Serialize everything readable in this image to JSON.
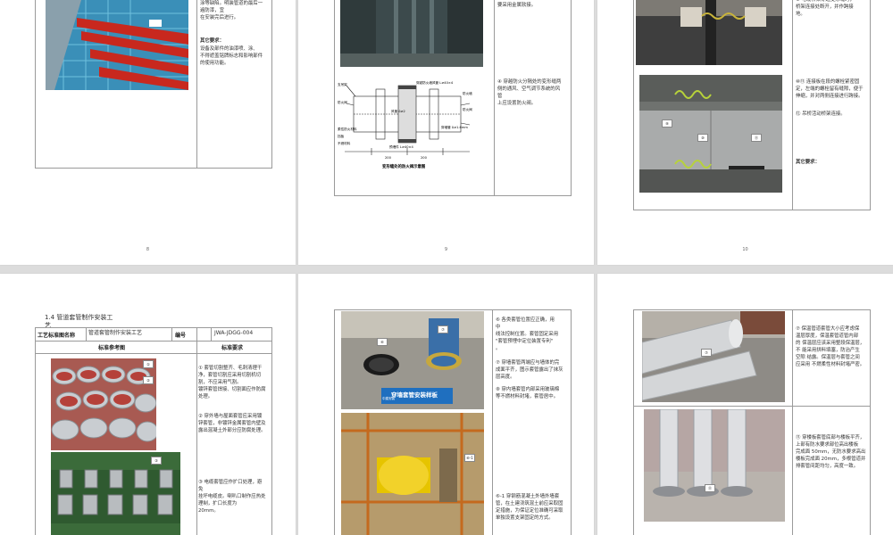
{
  "pages": [
    {
      "number": "8",
      "side_text": "涂等缺陷。明装管道的最后一\n遍防漆，宜\n在安装完后进行。",
      "req_title": "其它要求：",
      "req_text": "设备及部件的油漆喷、涂、\n不得遮盖铭牌标志和影响部件\n的使用功能。"
    },
    {
      "number": "9",
      "top_text": "要采用金属软接。",
      "item4": "④ 穿越防火分隔处的变形缝两\n侧的通风、空气调节系统的风\n管\n上应设置防火阀。",
      "diagram_caption": "变形缝处的防火阀示意图",
      "diagram_labels": [
        "支吊架",
        "防火阀",
        "穿越防火墙风管 L≥40×4",
        "防火墙",
        "风管 δ≥2",
        "穿墙管 δ≥1.6mm",
        "柔性防火材料",
        "挡板",
        "预埋件 L≥40×4",
        "200",
        "200",
        "不燃材料",
        "防火阀"
      ]
    },
    {
      "number": "10",
      "item_a": "⑨ 电缆桥架穿越变形缝时，\n桥架连接处断开，并作跨接\n地。",
      "item_b": "⑩⑪ 连接板在段的螺栓紧密固\n定，左端的螺栓留有缝隙，便于\n伸缩，并对两侧连接进行跨接。",
      "item_c": "⑫ 吊桥活动桥架连接。",
      "req_title": "其它要求：",
      "photo_tags": [
        "⑨",
        "⑩",
        "⑪"
      ]
    },
    {
      "number": "",
      "section_title": "1.4  管道套管制作安装工\n艺",
      "table_header": {
        "name_label": "工艺标准图名称",
        "name_value": "管道套管制作安装工艺",
        "code_label": "编号",
        "code_value": "JWA-JDGG-004",
        "ref_label": "标准参考图",
        "req_label": "标准要求"
      },
      "items": [
        "① 套管切割整齐、毛刺清理干\n净，套管切割应采用切割机切\n割，不应采用气割。\n镀锌套管焊接、切割面应作防腐\n处理。",
        "② 穿外墙与屋面套管应采用镀\n锌套管，非镀锌金属套管内壁及\n露出混凝土外部分应防腐处理。",
        "③ 电缆套管应作扩口处理，避\n免\n挂坏电缆皮。喇叭口制作应热处\n理制，扩口长度为\n20mm。"
      ],
      "photo_tags": [
        "①",
        "②",
        "③"
      ]
    },
    {
      "number": "",
      "items": [
        "⑥ 各类套管位置应正确，用\n中\n线法控制位置。套管固定采用\n\"套管预埋中定位装置专利\"\n。",
        "⑦ 穿墙套管两端应与墙体的完\n成面平齐，图示套管露出了抹灰\n层高度。",
        "⑧ 穿内墙套管内部采用玻璃棉\n等不燃材料封堵，套管居中。",
        "⑥-1 穿钢筋混凝土外墙外墙套\n管，在土建浇筑混土前应采取固\n定措施，为保证定位准确可采取\n单独设置支架固定的方式。"
      ],
      "banner": "穿墙套管安装样板",
      "banner_small": "中建安装",
      "photo_tags": [
        "⑥",
        "⑦",
        "⑥-1"
      ]
    },
    {
      "number": "",
      "items": [
        "⑦ 保温管道套管大小应考虑保\n温层厚度，保温套管道管内部\n的 保温层应该采用整段保温层，\n不 能采用拼料填塞，防治产生\n空隙 结露。保温层与套管之间\n应采用 不燃柔性材料封堵严密。",
        "⑪ 穿楼板套管底部与楼板平齐，\n上部有防水要求部位高出楼板\n完成面 50mm，无防水要求高出\n楼板完成面 20mm，多根管道并\n排套管间距均匀，高度一致。"
      ],
      "photo_tags": [
        "⑦",
        "⑪"
      ]
    }
  ]
}
